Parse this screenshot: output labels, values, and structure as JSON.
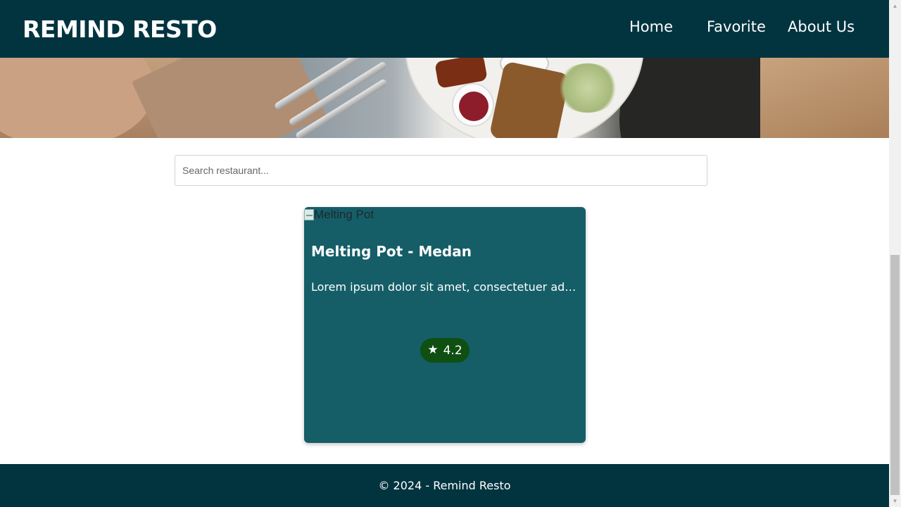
{
  "header": {
    "brand": "REMIND RESTO",
    "nav": [
      {
        "label": "Home"
      },
      {
        "label": "Favorite"
      },
      {
        "label": "About Us"
      }
    ]
  },
  "search": {
    "placeholder": "Search restaurant...",
    "value": ""
  },
  "restaurants": [
    {
      "image_alt": "Melting Pot",
      "title": "Melting Pot - Medan",
      "description": "Lorem ipsum dolor sit amet, consectetuer adipiscing elit.",
      "rating": "4.2",
      "rating_icon": "star-icon"
    }
  ],
  "footer": {
    "text": "© 2024 - Remind Resto"
  },
  "colors": {
    "header_bg": "#023440",
    "card_bg": "#155e67",
    "rating_bg": "#0f4f12",
    "footer_bg": "#023440"
  }
}
